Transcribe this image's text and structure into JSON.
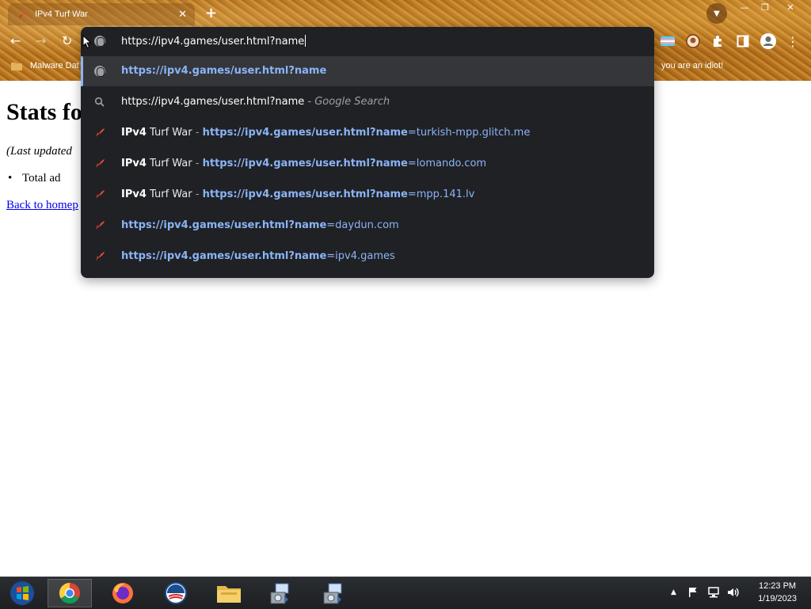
{
  "browser": {
    "tab": {
      "title": "IPv4 Turf War"
    },
    "window_controls": {
      "minimize": "—",
      "restore": "❐",
      "close": "✕"
    },
    "nav": {
      "back": "←",
      "forward": "→",
      "reload": "↻"
    },
    "bookmarks": {
      "first": "Malware Dat",
      "last": "you are an idiot!"
    },
    "theme_color": "#b9771f"
  },
  "page": {
    "title": "Stats fo",
    "updated": "(Last updated",
    "bullet": "Total ad",
    "home_link": "Back to homep"
  },
  "omnibox": {
    "input_value": "https://ipv4.games/user.html?name",
    "suggestions": [
      {
        "type": "url",
        "icon": "globe-icon",
        "url_bold": "https://ipv4.games/user.html?name",
        "url_rest": ""
      },
      {
        "type": "search",
        "icon": "search-icon",
        "query": "https://ipv4.games/user.html?name",
        "suffix": " - Google Search"
      },
      {
        "type": "history",
        "icon": "site-favicon",
        "title_bold": "IPv4",
        "title_rest": " Turf War",
        "sep": " - ",
        "url_bold": "https://ipv4.games/user.html?name",
        "url_rest": "=turkish-mpp.glitch.me"
      },
      {
        "type": "history",
        "icon": "site-favicon",
        "title_bold": "IPv4",
        "title_rest": " Turf War",
        "sep": " - ",
        "url_bold": "https://ipv4.games/user.html?name",
        "url_rest": "=lomando.com"
      },
      {
        "type": "history",
        "icon": "site-favicon",
        "title_bold": "IPv4",
        "title_rest": " Turf War",
        "sep": " - ",
        "url_bold": "https://ipv4.games/user.html?name",
        "url_rest": "=mpp.141.lv"
      },
      {
        "type": "history",
        "icon": "site-favicon",
        "url_bold": "https://ipv4.games/user.html?name",
        "url_rest": "=daydun.com"
      },
      {
        "type": "history",
        "icon": "site-favicon",
        "url_bold": "https://ipv4.games/user.html?name",
        "url_rest": "=ipv4.games"
      }
    ]
  },
  "taskbar": {
    "clock_time": "12:23 PM",
    "clock_date": "1/19/2023"
  }
}
